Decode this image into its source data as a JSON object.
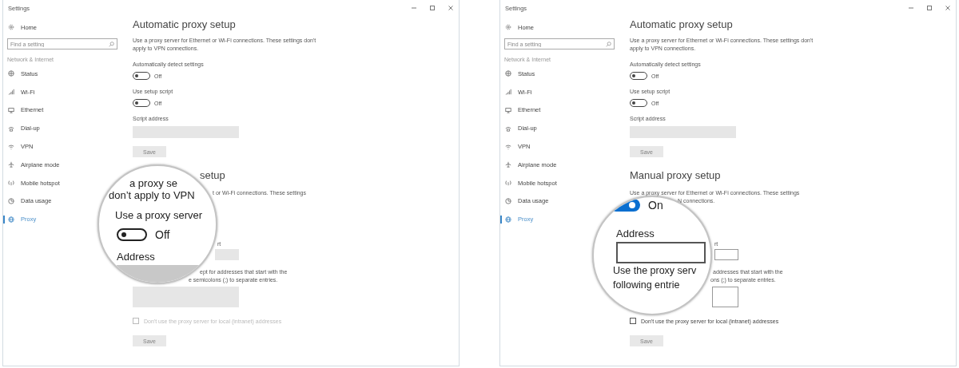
{
  "windows": [
    {
      "title": "Settings",
      "sidebar": {
        "home": "Home",
        "search": {
          "placeholder": "Find a setting"
        },
        "section": "Network & Internet",
        "items": [
          {
            "label": "Status",
            "selected": false
          },
          {
            "label": "Wi-Fi",
            "selected": false
          },
          {
            "label": "Ethernet",
            "selected": false
          },
          {
            "label": "Dial-up",
            "selected": false
          },
          {
            "label": "VPN",
            "selected": false
          },
          {
            "label": "Airplane mode",
            "selected": false
          },
          {
            "label": "Mobile hotspot",
            "selected": false
          },
          {
            "label": "Data usage",
            "selected": false
          },
          {
            "label": "Proxy",
            "selected": true
          }
        ]
      },
      "automatic": {
        "heading": "Automatic proxy setup",
        "description": "Use a proxy server for Ethernet or Wi-Fi connections. These settings don't apply to VPN connections.",
        "toggles": [
          {
            "label": "Automatically detect settings",
            "on": false,
            "state": "Off"
          },
          {
            "label": "Use setup script",
            "on": false,
            "state": "Off"
          }
        ],
        "script_address": {
          "label": "Script address",
          "disabled": true
        },
        "save": {
          "label": "Save",
          "disabled": true
        }
      },
      "manual": {
        "heading": "setup",
        "description": [
          "t or Wi-Fi connections. These settings"
        ],
        "port_label": "rt",
        "port_field": {
          "disabled": true
        },
        "exceptions": [
          "ept for addresses that start with the",
          "e semicolons (;) to separate entries."
        ],
        "exceptions_field": {
          "disabled": true
        },
        "checkbox": {
          "label": "Don't use the proxy server for local (intranet) addresses",
          "checked": false,
          "disabled": true
        },
        "save": {
          "label": "Save",
          "disabled": true
        }
      },
      "magnifier": {
        "lines_top": [
          "a proxy se",
          "don’t apply to VPN"
        ],
        "toggle_label": "Use a proxy server",
        "toggle": {
          "on": false,
          "state": "Off"
        },
        "address_label": "Address",
        "address_field": {
          "disabled": true
        }
      }
    },
    {
      "title": "Settings",
      "sidebar": {
        "home": "Home",
        "search": {
          "placeholder": "Find a setting"
        },
        "section": "Network & Internet",
        "items": [
          {
            "label": "Status",
            "selected": false
          },
          {
            "label": "Wi-Fi",
            "selected": false
          },
          {
            "label": "Ethernet",
            "selected": false
          },
          {
            "label": "Dial-up",
            "selected": false
          },
          {
            "label": "VPN",
            "selected": false
          },
          {
            "label": "Airplane mode",
            "selected": false
          },
          {
            "label": "Mobile hotspot",
            "selected": false
          },
          {
            "label": "Data usage",
            "selected": false
          },
          {
            "label": "Proxy",
            "selected": true
          }
        ]
      },
      "automatic": {
        "heading": "Automatic proxy setup",
        "description": "Use a proxy server for Ethernet or Wi-Fi connections. These settings don't apply to VPN connections.",
        "toggles": [
          {
            "label": "Automatically detect settings",
            "on": false,
            "state": "Off"
          },
          {
            "label": "Use setup script",
            "on": false,
            "state": "Off"
          }
        ],
        "script_address": {
          "label": "Script address",
          "disabled": true
        },
        "save": {
          "label": "Save",
          "disabled": true
        }
      },
      "manual": {
        "heading": "Manual proxy setup",
        "description": [
          "Use a proxy server for Ethernet or Wi-Fi connections. These settings",
          "N connections."
        ],
        "port_label": "rt",
        "port_field": {
          "disabled": false
        },
        "exceptions": [
          "addresses that start with the",
          "ons (;) to separate entries."
        ],
        "exceptions_field": {
          "disabled": false
        },
        "checkbox": {
          "label": "Don't use the proxy server for local (intranet) addresses",
          "checked": false,
          "disabled": false
        },
        "save": {
          "label": "Save",
          "disabled": true
        }
      },
      "magnifier": {
        "toggle": {
          "on": true,
          "state": "On"
        },
        "address_label": "Address",
        "address_field": {
          "disabled": false
        },
        "lines_bottom": [
          "Use the proxy serv",
          "following entrie"
        ]
      }
    }
  ]
}
